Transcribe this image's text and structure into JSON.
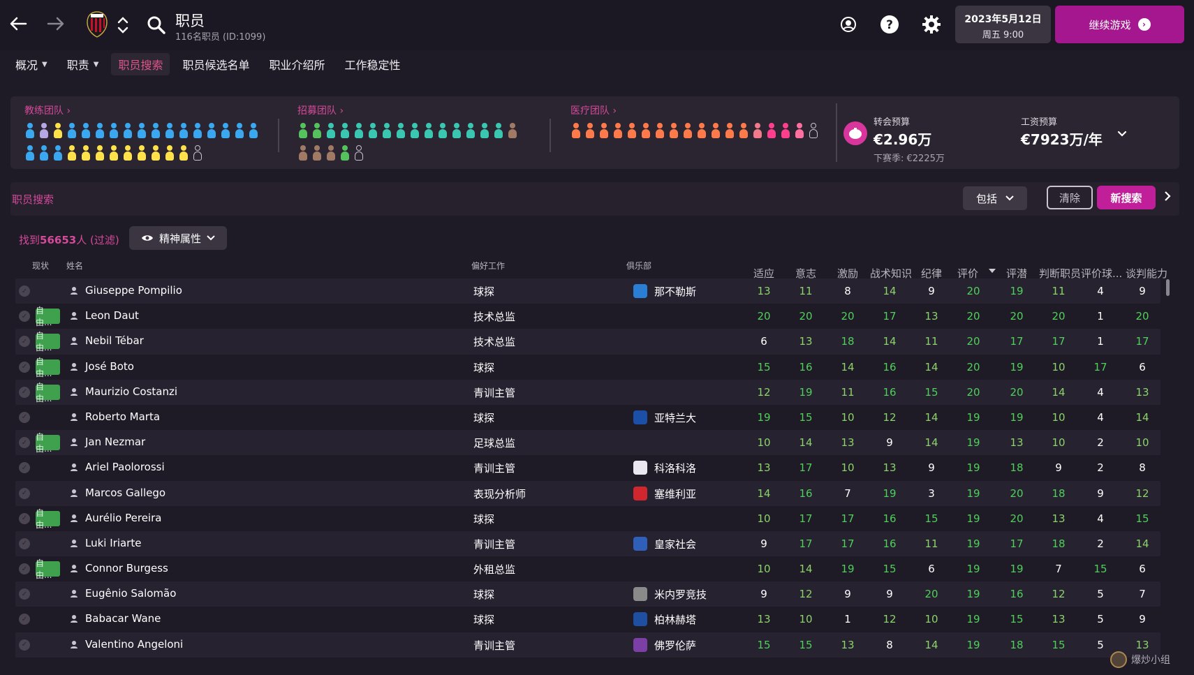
{
  "header": {
    "title": "职员",
    "subtitle": "116名职员 (ID:1099)",
    "date_line1": "2023年5月12日",
    "date_line2": "周五 9:00",
    "continue_label": "继续游戏"
  },
  "subnav": [
    {
      "label": "概况",
      "has_menu": true
    },
    {
      "label": "职责",
      "has_menu": true
    },
    {
      "label": "职员搜索",
      "has_menu": false,
      "active": true
    },
    {
      "label": "职员候选名单",
      "has_menu": false
    },
    {
      "label": "职业介绍所",
      "has_menu": false
    },
    {
      "label": "工作稳定性",
      "has_menu": false
    }
  ],
  "teams": {
    "coaching": {
      "title": "教练团队 ›"
    },
    "scouting": {
      "title": "招募团队 ›"
    },
    "medical": {
      "title": "医疗团队 ›"
    }
  },
  "budget": {
    "transfer_label": "转会预算",
    "transfer_value": "€2.96万",
    "transfer_next": "下赛季: €2225万",
    "wage_label": "工资预算",
    "wage_value": "€7923万/年"
  },
  "search": {
    "label": "职员搜索",
    "include_label": "包括",
    "clear_label": "清除",
    "new_label": "新搜索"
  },
  "results": {
    "found_prefix": "找到",
    "found_count": "56653",
    "found_suffix": "人 (过滤)",
    "attr_button": "精神属性"
  },
  "columns": {
    "status": "现状",
    "name": "姓名",
    "role": "偏好工作",
    "club": "俱乐部",
    "adapt": "适应",
    "will": "意志",
    "motiv": "激励",
    "tactic": "战术知识",
    "disc": "纪律",
    "rating": "评价",
    "potential": "评潜",
    "judge_staff": "判断职员",
    "judge_player": "评价球...",
    "negotiate": "谈判能力"
  },
  "colors": {
    "accent": "#d44a9b",
    "green_value": "#4fd05a",
    "white_value": "#ffffff",
    "free_badge": "#3fa14e",
    "continue_button": "#a4178f"
  },
  "staff": [
    {
      "free": false,
      "free_label": "",
      "name": "Giuseppe Pompilio",
      "role": "球探",
      "club": "那不勒斯",
      "club_color": "#2a7fd4",
      "stats": [
        13,
        11,
        8,
        14,
        9,
        20,
        19,
        11,
        4,
        9
      ]
    },
    {
      "free": true,
      "free_label": "自由...",
      "name": "Leon Daut",
      "role": "技术总监",
      "club": "",
      "club_color": "",
      "stats": [
        20,
        20,
        20,
        17,
        13,
        20,
        20,
        20,
        1,
        20
      ]
    },
    {
      "free": true,
      "free_label": "自由...",
      "name": "Nebil Tébar",
      "role": "技术总监",
      "club": "",
      "club_color": "",
      "stats": [
        6,
        13,
        18,
        14,
        11,
        20,
        17,
        17,
        1,
        17
      ]
    },
    {
      "free": true,
      "free_label": "自由...",
      "name": "José Boto",
      "role": "球探",
      "club": "",
      "club_color": "",
      "stats": [
        15,
        16,
        14,
        16,
        14,
        20,
        19,
        10,
        17,
        6
      ]
    },
    {
      "free": true,
      "free_label": "自由...",
      "name": "Maurizio Costanzi",
      "role": "青训主管",
      "club": "",
      "club_color": "",
      "stats": [
        12,
        19,
        11,
        16,
        15,
        20,
        20,
        14,
        4,
        13
      ]
    },
    {
      "free": false,
      "free_label": "",
      "name": "Roberto Marta",
      "role": "球探",
      "club": "亚特兰大",
      "club_color": "#1b4fa8",
      "stats": [
        19,
        15,
        10,
        12,
        14,
        19,
        19,
        10,
        4,
        14
      ]
    },
    {
      "free": true,
      "free_label": "自由...",
      "name": "Jan Nezmar",
      "role": "足球总监",
      "club": "",
      "club_color": "",
      "stats": [
        10,
        14,
        13,
        9,
        14,
        19,
        13,
        10,
        2,
        10
      ]
    },
    {
      "free": false,
      "free_label": "",
      "name": "Ariel Paolorossi",
      "role": "青训主管",
      "club": "科洛科洛",
      "club_color": "#e8e8ee",
      "stats": [
        13,
        17,
        10,
        13,
        9,
        19,
        18,
        9,
        2,
        8
      ]
    },
    {
      "free": false,
      "free_label": "",
      "name": "Marcos Gallego",
      "role": "表现分析师",
      "club": "塞维利亚",
      "club_color": "#d0272f",
      "stats": [
        14,
        16,
        7,
        19,
        3,
        19,
        20,
        18,
        9,
        12
      ]
    },
    {
      "free": true,
      "free_label": "自由...",
      "name": "Aurélio Pereira",
      "role": "球探",
      "club": "",
      "club_color": "",
      "stats": [
        10,
        17,
        17,
        16,
        15,
        19,
        20,
        13,
        4,
        15
      ]
    },
    {
      "free": false,
      "free_label": "",
      "name": "Luki Iriarte",
      "role": "青训主管",
      "club": "皇家社会",
      "club_color": "#2f5fb8",
      "stats": [
        9,
        17,
        17,
        16,
        11,
        19,
        17,
        18,
        2,
        14
      ]
    },
    {
      "free": true,
      "free_label": "自由...",
      "name": "Connor Burgess",
      "role": "外租总监",
      "club": "",
      "club_color": "",
      "stats": [
        10,
        14,
        19,
        15,
        6,
        19,
        19,
        7,
        15,
        6
      ]
    },
    {
      "free": false,
      "free_label": "",
      "name": "Eugênio Salomão",
      "role": "球探",
      "club": "米内罗竞技",
      "club_color": "#8a8a8a",
      "stats": [
        9,
        12,
        9,
        9,
        20,
        19,
        16,
        12,
        5,
        7
      ]
    },
    {
      "free": false,
      "free_label": "",
      "name": "Babacar Wane",
      "role": "球探",
      "club": "柏林赫塔",
      "club_color": "#1f4fa0",
      "stats": [
        13,
        10,
        1,
        12,
        10,
        19,
        15,
        13,
        5,
        9
      ]
    },
    {
      "free": false,
      "free_label": "",
      "name": "Valentino Angeloni",
      "role": "青训主管",
      "club": "佛罗伦萨",
      "club_color": "#7b3fa6",
      "stats": [
        15,
        15,
        13,
        8,
        14,
        19,
        18,
        15,
        5,
        13
      ]
    }
  ],
  "watermark": "爆炒小组"
}
